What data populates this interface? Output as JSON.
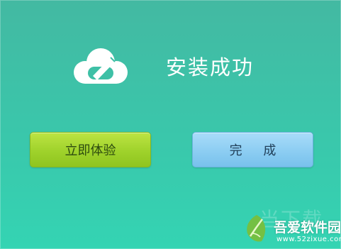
{
  "dialog": {
    "title": "安装成功",
    "primary_button": "立即体验",
    "secondary_button": "完 成"
  },
  "icons": {
    "logo": "cloud-pencil-icon",
    "watermark_logo": "leaf-logo-icon"
  },
  "watermark": {
    "ghost_text": "当下载",
    "name": "吾爱软件园",
    "url": "www.52zixue.com"
  },
  "colors": {
    "background_top": "#43b9a2",
    "background_bottom": "#34d4b3",
    "primary_button": "#a6d630",
    "secondary_button": "#8ccdf2"
  }
}
